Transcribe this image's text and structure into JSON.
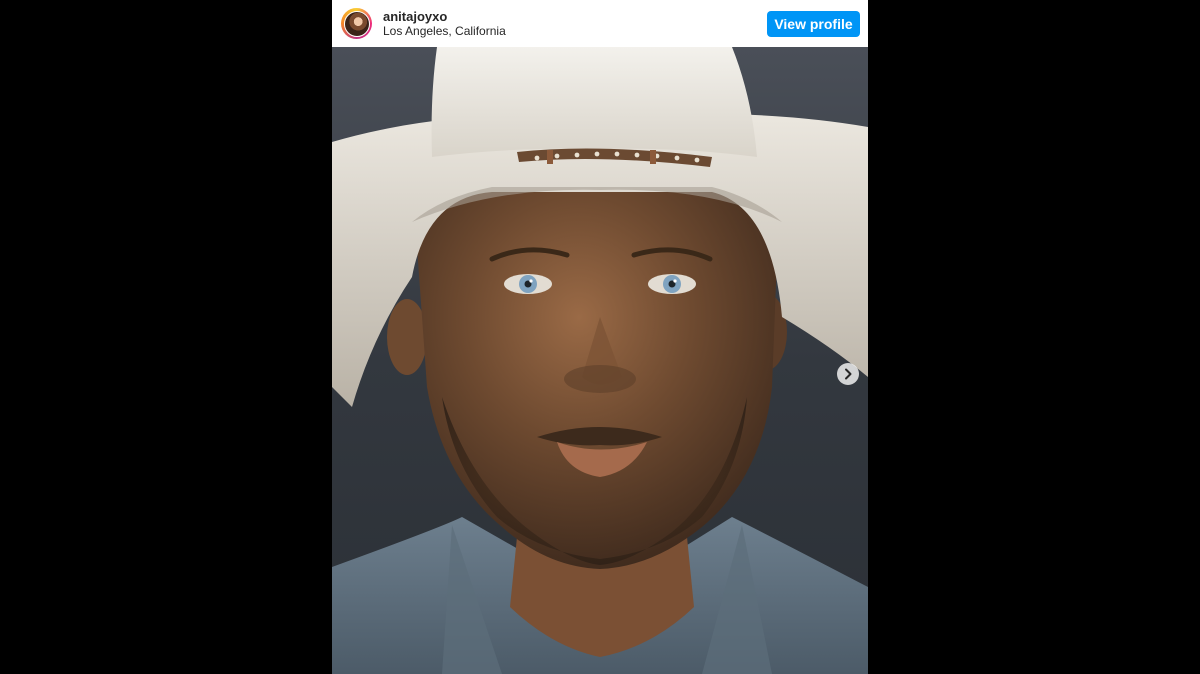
{
  "post": {
    "username": "anitajoyxo",
    "location": "Los Angeles, California",
    "view_profile_label": "View profile"
  },
  "icons": {
    "avatar": "profile-picture",
    "next": "chevron-right-icon"
  },
  "colors": {
    "background": "#000000",
    "card": "#ffffff",
    "button": "#0095f6",
    "text": "#262626"
  }
}
